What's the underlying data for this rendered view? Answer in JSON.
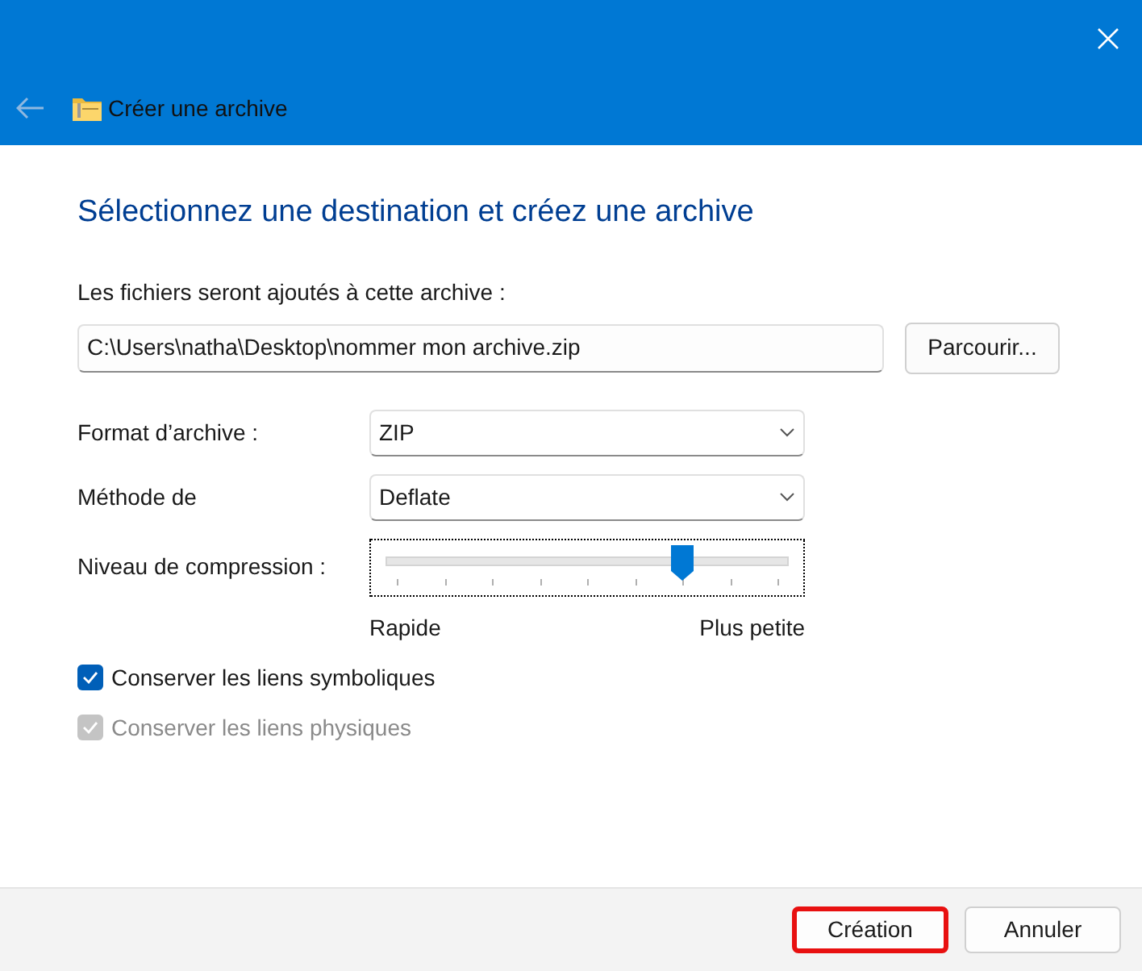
{
  "window": {
    "title": "Créer une archive"
  },
  "heading": "Sélectionnez une destination et créez une archive",
  "destination": {
    "label": "Les fichiers seront ajoutés à cette archive :",
    "value": "C:\\Users\\natha\\Desktop\\nommer mon archive.zip",
    "browse": "Parcourir..."
  },
  "format": {
    "label": "Format d’archive :",
    "value": "ZIP"
  },
  "method": {
    "label": "Méthode de",
    "value": "Deflate"
  },
  "compression": {
    "label": "Niveau de compression :",
    "level": 0.75,
    "min_label": "Rapide",
    "max_label": "Plus petite"
  },
  "options": [
    {
      "label": "Conserver les liens symboliques",
      "checked": true,
      "disabled": false
    },
    {
      "label": "Conserver les liens physiques",
      "checked": true,
      "disabled": true
    }
  ],
  "buttons": [
    {
      "label": "Création",
      "highlighted": true
    },
    {
      "label": "Annuler",
      "highlighted": false
    }
  ]
}
